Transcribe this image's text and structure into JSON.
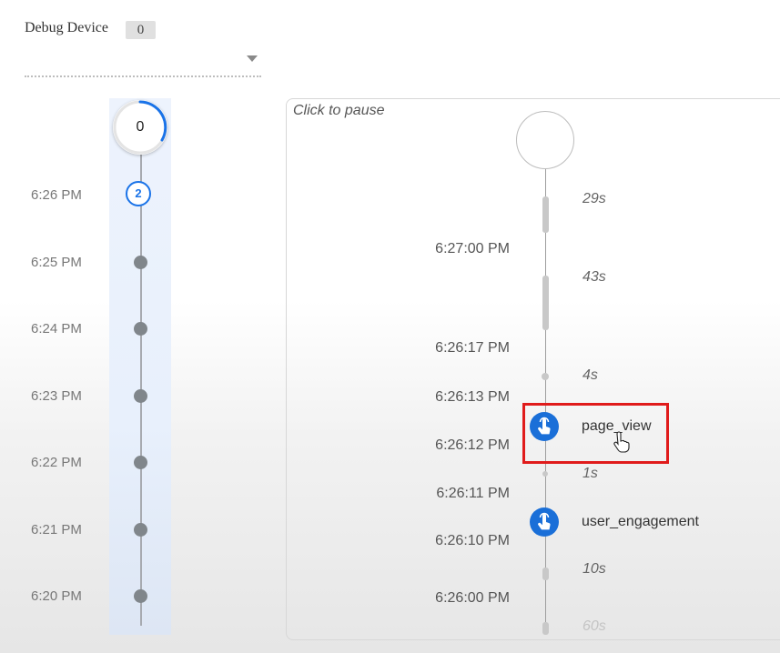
{
  "debug_device": {
    "label": "Debug Device",
    "count": "0",
    "selected_device": ""
  },
  "minutes": {
    "top_count": "0",
    "badge_count": "2",
    "times": [
      "6:26 PM",
      "6:25 PM",
      "6:24 PM",
      "6:23 PM",
      "6:22 PM",
      "6:21 PM",
      "6:20 PM"
    ]
  },
  "stream": {
    "pause_label": "Click to pause",
    "timestamps": [
      "6:27:00 PM",
      "6:26:17 PM",
      "6:26:13 PM",
      "6:26:12 PM",
      "6:26:11 PM",
      "6:26:10 PM",
      "6:26:00 PM"
    ],
    "gaps": [
      "29s",
      "43s",
      "4s",
      "1s",
      "10s",
      "60s"
    ],
    "events": [
      {
        "name": "page_view",
        "icon": "touch-icon",
        "highlighted": true
      },
      {
        "name": "user_engagement",
        "icon": "touch-icon",
        "highlighted": false
      }
    ]
  },
  "colors": {
    "accent": "#1a73e8",
    "event_icon": "#1a6fd8",
    "highlight": "#e01b1b",
    "minute_band": "#e8f0fc"
  }
}
